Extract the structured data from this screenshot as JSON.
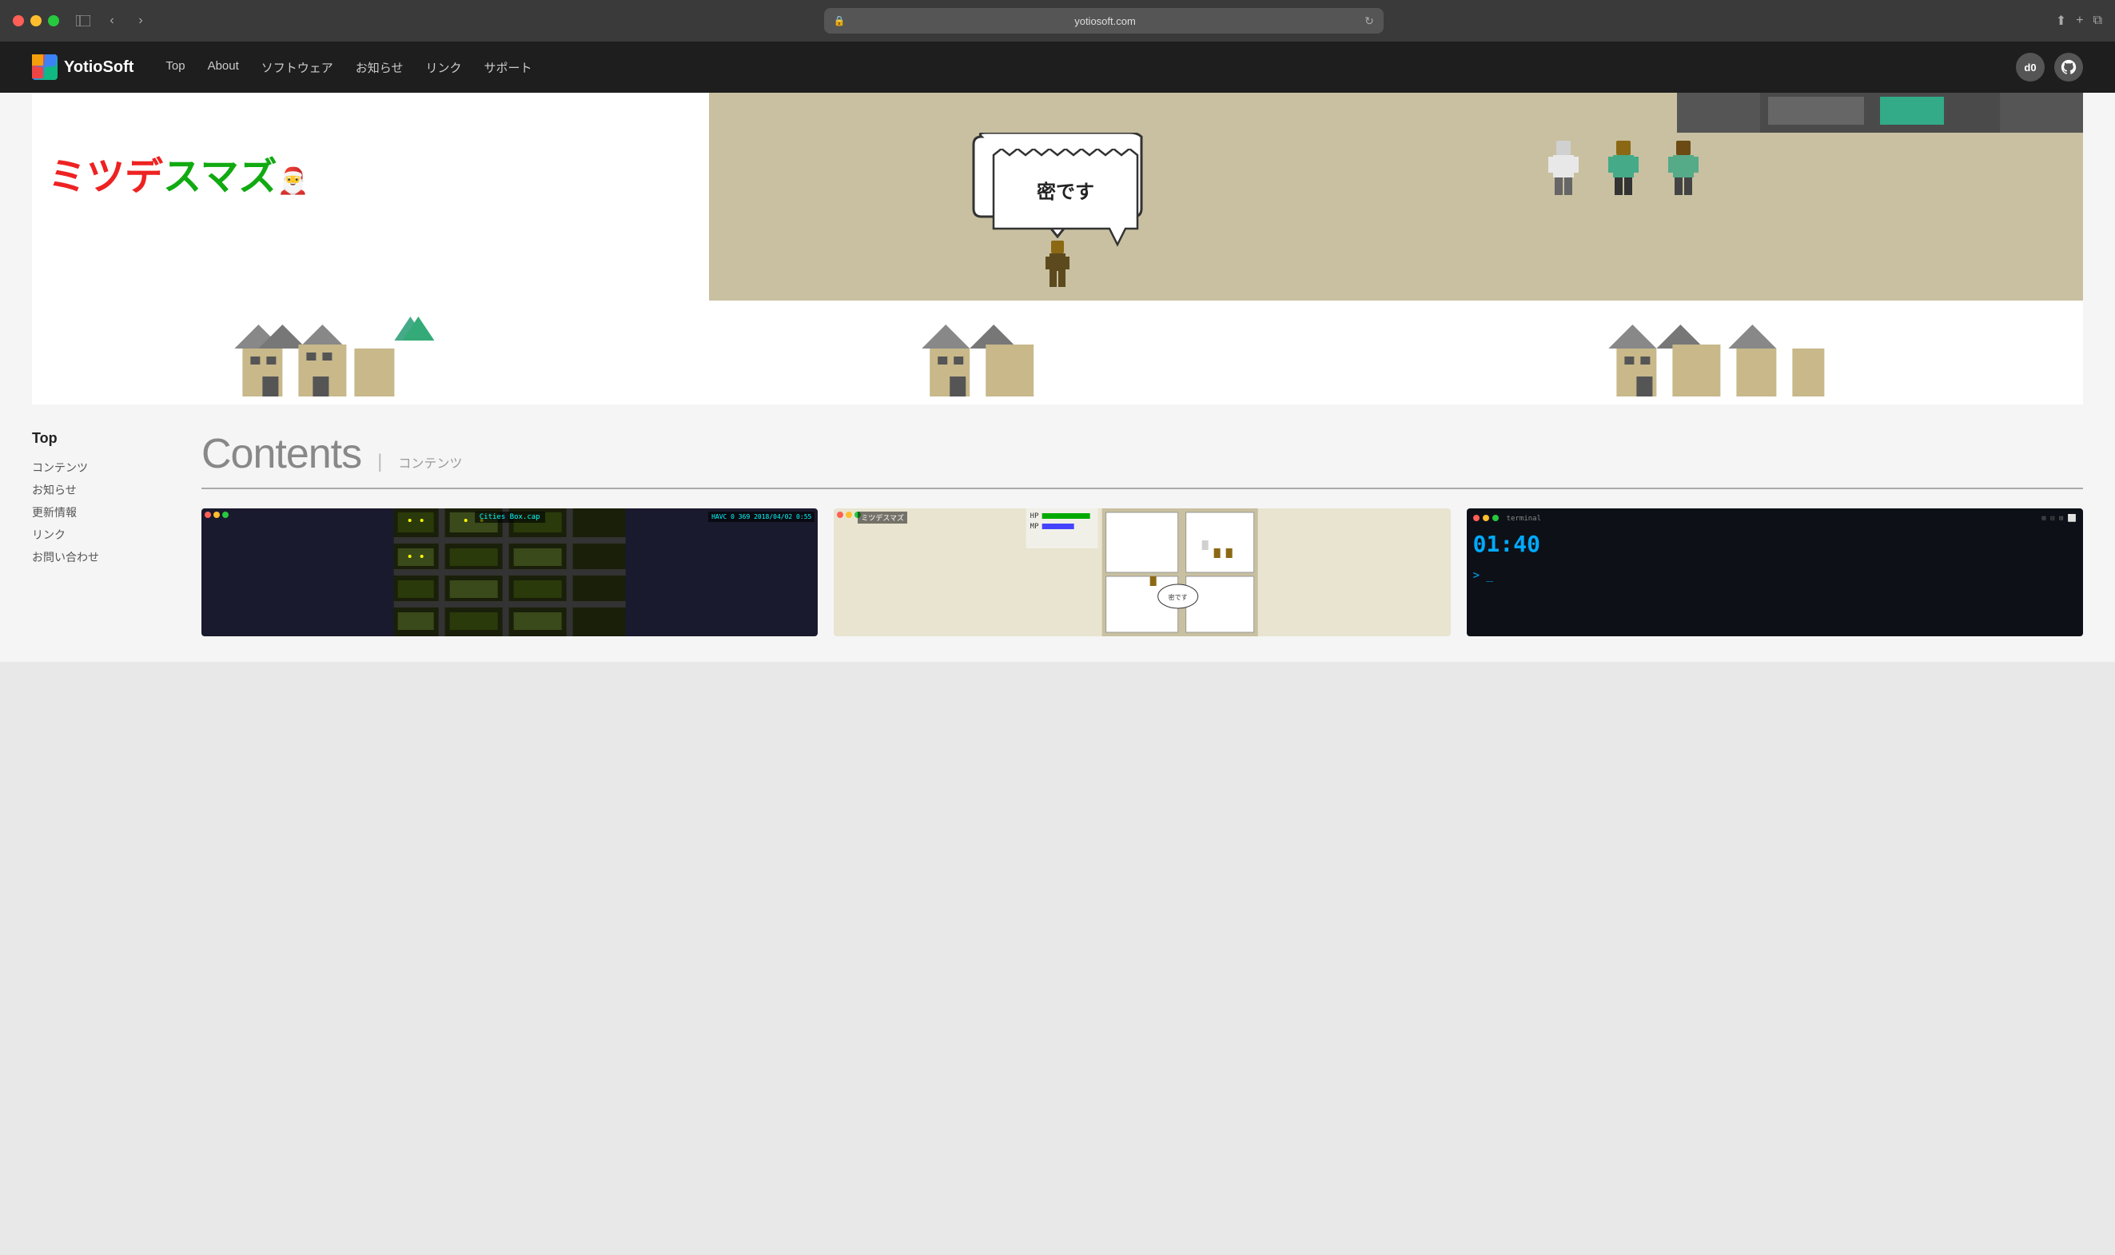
{
  "browser": {
    "url": "yotiosoft.com",
    "back_btn": "‹",
    "forward_btn": "›",
    "reload_btn": "↻",
    "share_btn": "⬆",
    "new_tab_btn": "+",
    "tab_btn": "⧉"
  },
  "nav": {
    "logo_text": "YotioSoft",
    "links": [
      {
        "label": "Top"
      },
      {
        "label": "About"
      },
      {
        "label": "ソフトウェア"
      },
      {
        "label": "お知らせ"
      },
      {
        "label": "リンク"
      },
      {
        "label": "サポート"
      }
    ],
    "d0_label": "d0",
    "github_label": "⊙"
  },
  "hero": {
    "title_jp": "ミツデスマズ",
    "speech_text": "密です",
    "top_right_area": ""
  },
  "sidebar": {
    "title": "Top",
    "links": [
      {
        "label": "コンテンツ"
      },
      {
        "label": "お知らせ"
      },
      {
        "label": "更新情報"
      },
      {
        "label": "リンク"
      },
      {
        "label": "お問い合わせ"
      }
    ]
  },
  "contents": {
    "title_en": "Contents",
    "separator": "|",
    "title_jp": "コンテンツ",
    "cards": [
      {
        "id": "cities-box",
        "title": "Cities Box.cap",
        "hud": "HAVC 0 369    2018/04/02 0:55"
      },
      {
        "id": "mitsudes-maz",
        "title": "ミツデスマズ",
        "subtitle": "密です"
      },
      {
        "id": "terminal",
        "title": "terminal",
        "content_lines": [
          "01:40",
          "> _"
        ]
      }
    ]
  }
}
